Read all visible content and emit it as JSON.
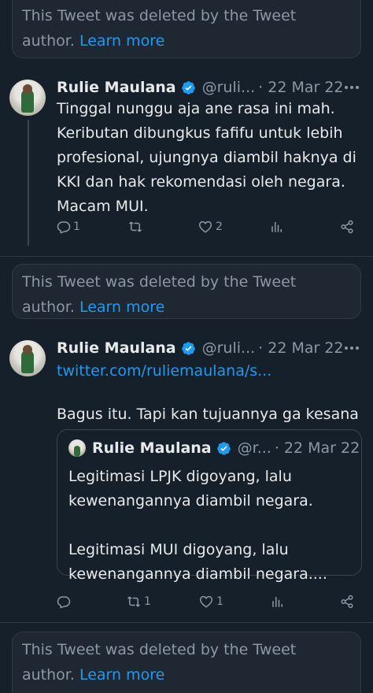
{
  "deleted_notice": {
    "text": "This Tweet was deleted by the Tweet author.",
    "link": "Learn more"
  },
  "tweets": [
    {
      "name": "Rulie Maulana",
      "handle": "@ruli...",
      "date": "· 22 Mar 22",
      "text": "Tinggal nunggu aja ane rasa ini mah. Keributan dibungkus fafifu untuk lebih profesional, ujungnya diambil haknya di KKI dan hak rekomendasi oleh negara. Macam MUI.",
      "replies": "1",
      "retweets": "",
      "likes": "2"
    },
    {
      "name": "Rulie Maulana",
      "handle": "@ruli...",
      "date": "· 22 Mar 22",
      "link": "twitter.com/ruliemaulana/s...",
      "text": "Bagus itu. Tapi kan tujuannya ga kesana",
      "replies": "",
      "retweets": "1",
      "likes": "1",
      "quote": {
        "name": "Rulie Maulana",
        "handle": "@r...",
        "date": "· 22 Mar 22",
        "text_1": "Legitimasi LPJK digoyang, lalu kewenangannya diambil negara.",
        "text_2": "Legitimasi MUI digoyang, lalu kewenangannya diambil negara...."
      }
    }
  ],
  "colors": {
    "background": "#15202b",
    "link": "#1d9bf0",
    "verified": "#1d9bf0",
    "muted": "#8b98a5"
  },
  "icons": [
    "more-icon",
    "reply-icon",
    "retweet-icon",
    "like-icon",
    "views-icon",
    "share-icon",
    "verified-icon"
  ]
}
